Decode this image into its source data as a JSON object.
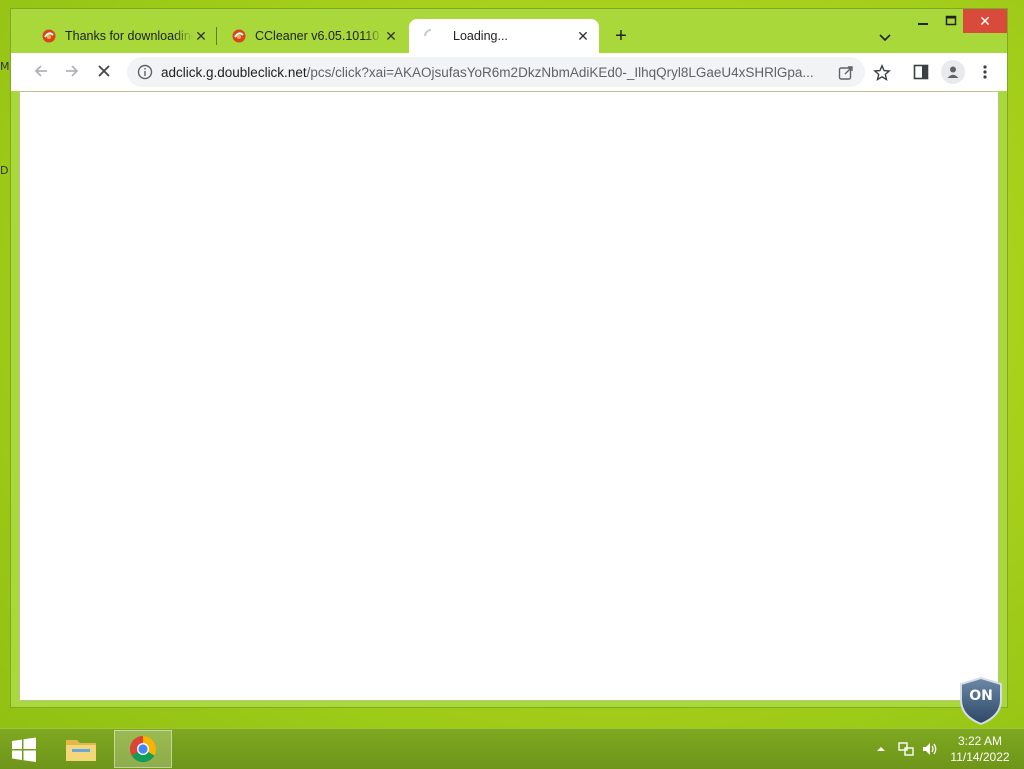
{
  "desktop": {
    "edge_glyphs": [
      "M",
      "D"
    ]
  },
  "tabs": [
    {
      "title": "Thanks for downloading",
      "favicon": "ccleaner-icon",
      "state": "inactive"
    },
    {
      "title": "CCleaner v6.05.10110",
      "favicon": "ccleaner-icon",
      "state": "inactive"
    },
    {
      "title": "Loading...",
      "favicon": "loading-spinner-icon",
      "state": "active"
    }
  ],
  "toolbar": {
    "url_host": "adclick.g.doubleclick.net",
    "url_path": "/pcs/click?xai=AKAOjsufasYoR6m2DkzNbmAdiKEd0-_IlhqQryl8LGaeU4xSHRlGpa...",
    "reload_state": "stop"
  },
  "taskbar": {
    "time": "3:22 AM",
    "date": "11/14/2022"
  },
  "badge": {
    "text": "ON"
  },
  "colors": {
    "accent": "#a8d83a",
    "close_button": "#d84a3a"
  }
}
